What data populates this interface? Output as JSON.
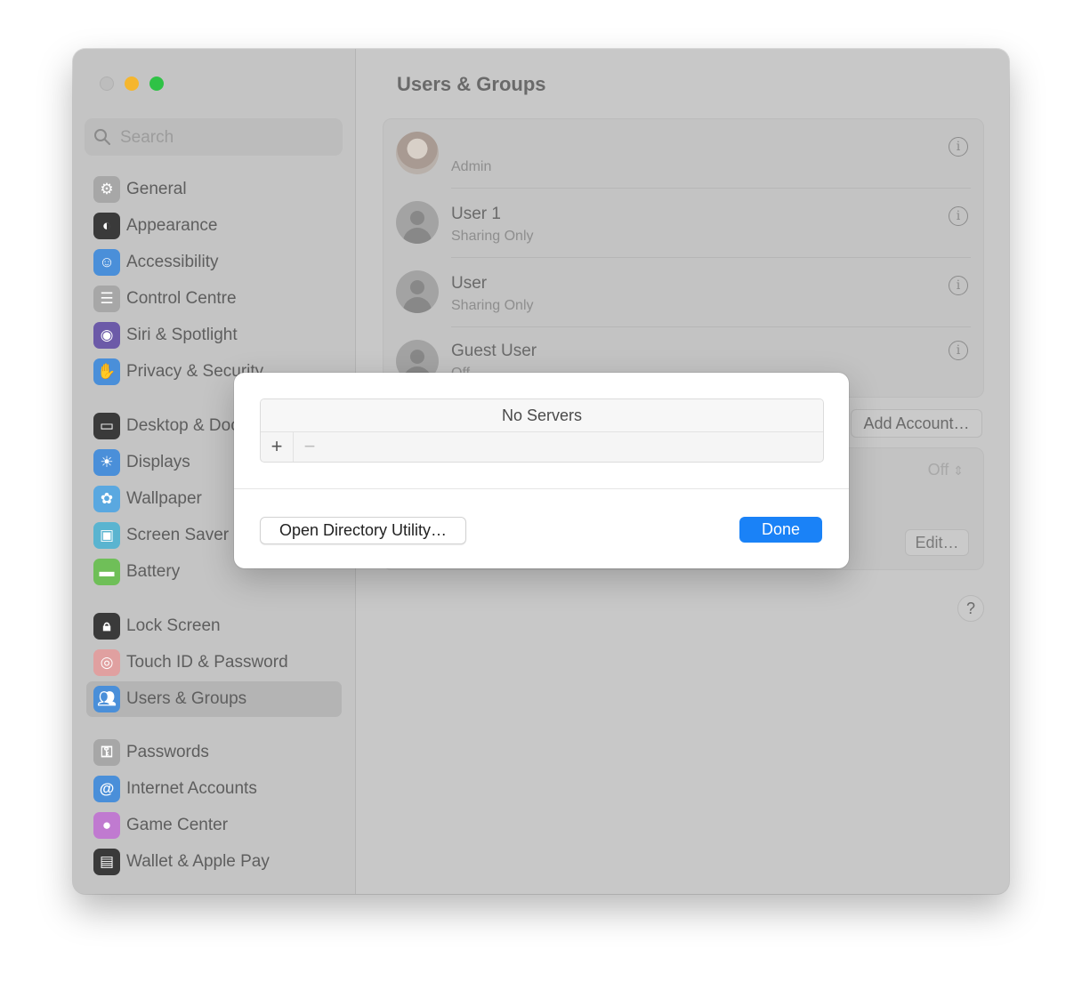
{
  "window": {
    "title": "Users & Groups"
  },
  "search": {
    "placeholder": "Search"
  },
  "sidebar": {
    "items": [
      {
        "label": "General",
        "icon": "gear-icon",
        "color": "#a7a7a7"
      },
      {
        "label": "Appearance",
        "icon": "appearance-icon",
        "color": "#3a3a3a"
      },
      {
        "label": "Accessibility",
        "icon": "accessibility-icon",
        "color": "#4a8fd9"
      },
      {
        "label": "Control Centre",
        "icon": "control-centre-icon",
        "color": "#a7a7a7"
      },
      {
        "label": "Siri & Spotlight",
        "icon": "siri-icon",
        "color": "#6c5aa8"
      },
      {
        "label": "Privacy & Security",
        "icon": "hand-icon",
        "color": "#4a8fd9"
      },
      {
        "label": "Desktop & Dock",
        "icon": "dock-icon",
        "color": "#3a3a3a"
      },
      {
        "label": "Displays",
        "icon": "sun-icon",
        "color": "#4a8fd9"
      },
      {
        "label": "Wallpaper",
        "icon": "flower-icon",
        "color": "#5aa8e0"
      },
      {
        "label": "Screen Saver",
        "icon": "screen-saver-icon",
        "color": "#5ab4d0"
      },
      {
        "label": "Battery",
        "icon": "battery-icon",
        "color": "#6fbf58"
      },
      {
        "label": "Lock Screen",
        "icon": "lock-icon",
        "color": "#3a3a3a"
      },
      {
        "label": "Touch ID & Password",
        "icon": "fingerprint-icon",
        "color": "#e0a0a0"
      },
      {
        "label": "Users & Groups",
        "icon": "users-icon",
        "color": "#4a8fd9"
      },
      {
        "label": "Passwords",
        "icon": "key-icon",
        "color": "#a7a7a7"
      },
      {
        "label": "Internet Accounts",
        "icon": "at-icon",
        "color": "#4a8fd9"
      },
      {
        "label": "Game Center",
        "icon": "game-center-icon",
        "color": "#c07ad0"
      },
      {
        "label": "Wallet & Apple Pay",
        "icon": "wallet-icon",
        "color": "#3a3a3a"
      }
    ],
    "selected": "Users & Groups"
  },
  "users": [
    {
      "name": "",
      "role": "Admin"
    },
    {
      "name": "User 1",
      "role": "Sharing Only"
    },
    {
      "name": "User",
      "role": "Sharing Only"
    },
    {
      "name": "Guest User",
      "role": "Off"
    }
  ],
  "main": {
    "add_account_label": "Add Account…",
    "off_select_value": "Off",
    "edit_label": "Edit…",
    "help_label": "?"
  },
  "dialog": {
    "list_header": "No Servers",
    "plus_label": "+",
    "minus_label": "−",
    "open_directory_label": "Open Directory Utility…",
    "done_label": "Done"
  }
}
